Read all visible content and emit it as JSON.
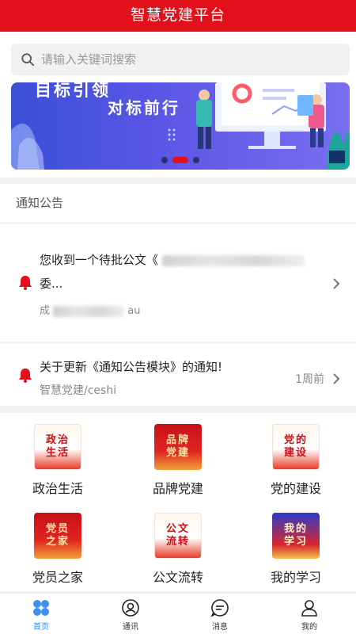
{
  "header": {
    "title": "智慧党建平台"
  },
  "search": {
    "placeholder": "请输入关键词搜索"
  },
  "banner": {
    "slogan_top": "目标引领",
    "slogan_bottom": "对标前行",
    "slides": 3,
    "active_slide": 2
  },
  "notices": {
    "heading": "通知公告",
    "items": [
      {
        "title_prefix": "您收到一个待批公文《",
        "title_line2": "委...",
        "subtitle_prefix": "成",
        "subtitle_suffix": "au",
        "time": ""
      },
      {
        "title": "关于更新《通知公告模块》的通知!",
        "subtitle": "智慧党建/ceshi",
        "time": "1周前"
      }
    ]
  },
  "modules": [
    {
      "label": "政治生活",
      "art_text": "政治生活"
    },
    {
      "label": "品牌党建",
      "art_text": "品牌党建"
    },
    {
      "label": "党的建设",
      "art_text": "党的建设"
    },
    {
      "label": "党员之家",
      "art_text": "党员之家"
    },
    {
      "label": "公文流转",
      "art_text": "公文流转"
    },
    {
      "label": "我的学习",
      "art_text": "我的学习"
    }
  ],
  "tabbar": {
    "items": [
      {
        "label": "首页",
        "icon": "home-icon",
        "active": true
      },
      {
        "label": "通讯",
        "icon": "contacts-icon"
      },
      {
        "label": "消息",
        "icon": "message-icon"
      },
      {
        "label": "我的",
        "icon": "profile-icon"
      }
    ]
  },
  "colors": {
    "primary_red": "#e3101b",
    "active_tab": "#2d86e6"
  }
}
